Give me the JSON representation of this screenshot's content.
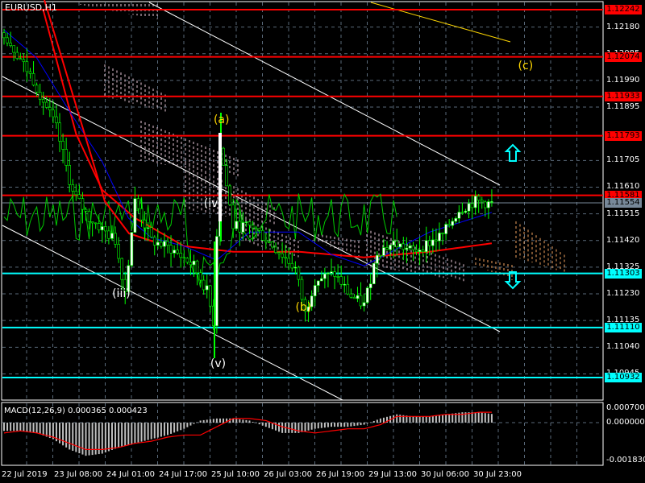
{
  "chart": {
    "title": "EURUSD,H1"
  },
  "colors": {
    "bg": "#000000",
    "grid": "#5a6a7a",
    "resistance": "#ff0000",
    "support": "#00ffff",
    "current": "#778899",
    "wave_yellow": "#ffd700",
    "wave_white": "#ffffff",
    "candle_wick": "#00ff00",
    "bull_body": "#ffffff",
    "bear_body": "#000000"
  },
  "price_levels": {
    "resistance": [
      "1.12242",
      "1.12074",
      "1.11933",
      "1.11793",
      "1.11581"
    ],
    "support": [
      "1.11303",
      "1.11110",
      "1.10932"
    ],
    "current": "1.11554"
  },
  "wave_labels": [
    {
      "text": "(a)",
      "price": 1.1185,
      "bar": 66,
      "color": "yellow"
    },
    {
      "text": "(c)",
      "price": 1.1204,
      "bar": 159,
      "color": "yellow"
    },
    {
      "text": "(iv)",
      "price": 1.1155,
      "bar": 63,
      "color": "white"
    },
    {
      "text": "(iii)",
      "price": 1.1123,
      "bar": 35,
      "color": "white"
    },
    {
      "text": "(b)",
      "price": 1.1118,
      "bar": 91,
      "color": "yellow"
    },
    {
      "text": "(v)",
      "price": 1.1098,
      "bar": 65,
      "color": "white"
    }
  ],
  "arrows": [
    {
      "name": "up-arrow",
      "dir": "up"
    },
    {
      "name": "down-arrow",
      "dir": "down"
    }
  ],
  "chart_data": [
    {
      "type": "candlestick",
      "title": "EURUSD,H1",
      "y_ticks": [
        "1.12180",
        "1.12085",
        "1.11990",
        "1.11895",
        "1.11705",
        "1.11610",
        "1.11515",
        "1.11420",
        "1.11325",
        "1.11230",
        "1.11135",
        "1.11040",
        "1.10945"
      ],
      "ylim": [
        1.1078,
        1.1228
      ],
      "x_ticks": [
        "22 Jul 2019",
        "23 Jul 08:00",
        "24 Jul 01:00",
        "24 Jul 17:00",
        "25 Jul 10:00",
        "26 Jul 03:00",
        "26 Jul 19:00",
        "29 Jul 13:00",
        "30 Jul 06:00",
        "30 Jul 23:00"
      ],
      "close_waypoints": {
        "bar": [
          0,
          9,
          16,
          21,
          26,
          34,
          37,
          40,
          45,
          51,
          58,
          62,
          64,
          66,
          70,
          76,
          84,
          89,
          92,
          95,
          101,
          106,
          110,
          114,
          119,
          125,
          134,
          139,
          144,
          149
        ],
        "price": [
          1.1216,
          1.1199,
          1.1182,
          1.1159,
          1.115,
          1.1142,
          1.1124,
          1.1156,
          1.1142,
          1.1139,
          1.1133,
          1.1124,
          1.1113,
          1.1176,
          1.1147,
          1.1147,
          1.1138,
          1.1132,
          1.1116,
          1.1128,
          1.113,
          1.1122,
          1.1119,
          1.1138,
          1.1141,
          1.1138,
          1.1144,
          1.1153,
          1.1156,
          1.1155
        ]
      },
      "moving_averages": [
        {
          "name": "MA-slow",
          "color": "#ff0000",
          "bar": [
            12,
            22,
            30,
            40,
            55,
            70,
            90,
            110,
            130,
            149
          ],
          "price": [
            1.1224,
            1.118,
            1.116,
            1.115,
            1.114,
            1.1138,
            1.1138,
            1.1136,
            1.1138,
            1.1141
          ]
        },
        {
          "name": "MA-fast",
          "color": "#0000ff",
          "bar": [
            0,
            10,
            20,
            30,
            38,
            45,
            55,
            65,
            75,
            90,
            100,
            110,
            130,
            149
          ],
          "price": [
            1.1217,
            1.1207,
            1.1188,
            1.117,
            1.115,
            1.1143,
            1.114,
            1.1135,
            1.1145,
            1.1145,
            1.1137,
            1.1133,
            1.1145,
            1.1152
          ]
        }
      ]
    },
    {
      "type": "bar",
      "title": "MACD(12,26,9) 0.000365 0.000423",
      "y_ticks": [
        "0.000700",
        "0.000000",
        "-0.001830"
      ],
      "ylim": [
        -0.00183,
        0.0007
      ],
      "histogram": [
        -0.0004,
        -0.0004,
        -0.0005,
        -0.0008,
        -0.0013,
        -0.0016,
        -0.0015,
        -0.0012,
        -0.001,
        -0.0008,
        -0.0006,
        -0.0003,
        0.0001,
        0.0002,
        0.0002,
        0.0001,
        -0.0002,
        -0.0005,
        -0.0005,
        -0.0003,
        -0.0002,
        -0.0002,
        -0.0001,
        0.0002,
        0.0004,
        0.0003,
        0.0003,
        0.0004,
        0.0005,
        0.0005,
        0.0004
      ],
      "signal": [
        -0.0005,
        -0.0004,
        -0.0005,
        -0.0007,
        -0.001,
        -0.0013,
        -0.0013,
        -0.0012,
        -0.001,
        -0.0009,
        -0.0007,
        -0.0006,
        -0.0006,
        -0.0002,
        0.0002,
        0.0002,
        0.0001,
        -0.0002,
        -0.0004,
        -0.0005,
        -0.0004,
        -0.0003,
        -0.0003,
        -0.0001,
        0.0003,
        0.0003,
        0.0003,
        0.0004,
        0.0004,
        0.0005,
        0.0005
      ]
    }
  ]
}
